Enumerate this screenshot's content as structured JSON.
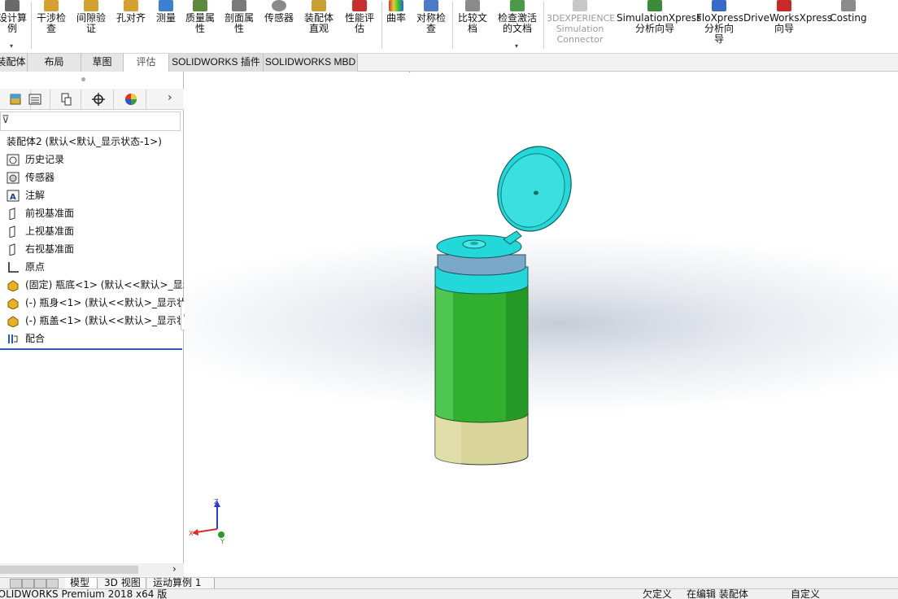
{
  "ribbon": {
    "items": [
      {
        "label": "设计算\n例",
        "icon": "design-study-icon",
        "dropdown": true
      },
      {
        "label": "干涉检\n查",
        "icon": "interference-check-icon"
      },
      {
        "label": "间隙验\n证",
        "icon": "clearance-icon"
      },
      {
        "label": "孔对齐",
        "icon": "hole-alignment-icon"
      },
      {
        "label": "测量",
        "icon": "measure-icon"
      },
      {
        "label": "质量属\n性",
        "icon": "mass-properties-icon"
      },
      {
        "label": "剖面属\n性",
        "icon": "section-properties-icon"
      },
      {
        "label": "传感器",
        "icon": "sensor-icon"
      },
      {
        "label": "装配体\n直观",
        "icon": "assemblyxpert-icon"
      },
      {
        "label": "性能评\n估",
        "icon": "performance-evaluation-icon"
      },
      {
        "label": "曲率",
        "icon": "curvature-icon"
      },
      {
        "label": "对称检\n查",
        "icon": "symmetry-check-icon"
      },
      {
        "label": "比较文\n档",
        "icon": "compare-documents-icon"
      },
      {
        "label": "检查激活\n的文档",
        "icon": "check-active-document-icon",
        "dropdown": true
      },
      {
        "label": "3DEXPERIENCE\nSimulation\nConnector",
        "icon": "3dexperience-icon",
        "disabled": true
      },
      {
        "label": "SimulationXpress\n分析向导",
        "icon": "simulationxpress-icon"
      },
      {
        "label": "FloXpress\n分析向\n导",
        "icon": "floxpress-icon"
      },
      {
        "label": "DriveWorksXpress\n向导",
        "icon": "driveworksxpress-icon"
      },
      {
        "label": "Costing",
        "icon": "costing-icon"
      }
    ]
  },
  "tabs": [
    {
      "label": "装配体"
    },
    {
      "label": "布局"
    },
    {
      "label": "草图"
    },
    {
      "label": "评估",
      "active": true
    },
    {
      "label": "SOLIDWORKS 插件"
    },
    {
      "label": "SOLIDWORKS MBD"
    }
  ],
  "feature_tree": {
    "root": "装配体2  (默认<默认_显示状态-1>)",
    "items": [
      {
        "label": "历史记录",
        "icon": "history-icon"
      },
      {
        "label": "传感器",
        "icon": "sensor-folder-icon"
      },
      {
        "label": "注解",
        "icon": "annotation-icon"
      },
      {
        "label": "前视基准面",
        "icon": "plane-icon"
      },
      {
        "label": "上视基准面",
        "icon": "plane-icon"
      },
      {
        "label": "右视基准面",
        "icon": "plane-icon"
      },
      {
        "label": "原点",
        "icon": "origin-icon"
      },
      {
        "label": "(固定) 瓶底<1> (默认<<默认>_显示",
        "icon": "part-icon"
      },
      {
        "label": "(-) 瓶身<1> (默认<<默认>_显示状",
        "icon": "part-icon"
      },
      {
        "label": "(-) 瓶盖<1> (默认<<默认>_显示状",
        "icon": "part-icon"
      },
      {
        "label": "配合",
        "icon": "mates-icon"
      }
    ]
  },
  "triad": {
    "z": "Z",
    "x": "X",
    "y": "Y"
  },
  "bottom_tabs": [
    {
      "label": "模型",
      "active": true
    },
    {
      "label": "3D 视图"
    },
    {
      "label": "运动算例 1"
    }
  ],
  "status": {
    "product": "SOLIDWORKS Premium 2018 x64 版",
    "defined": "欠定义",
    "editing": "在编辑 装配体",
    "units": "自定义"
  },
  "colors": {
    "bottle_cap": "#22d8d8",
    "bottle_body": "#2fb02f",
    "bottle_base": "#d8d49a",
    "ribbon_bg": "#ffffff",
    "tree_highlight": "#2a5db0"
  }
}
